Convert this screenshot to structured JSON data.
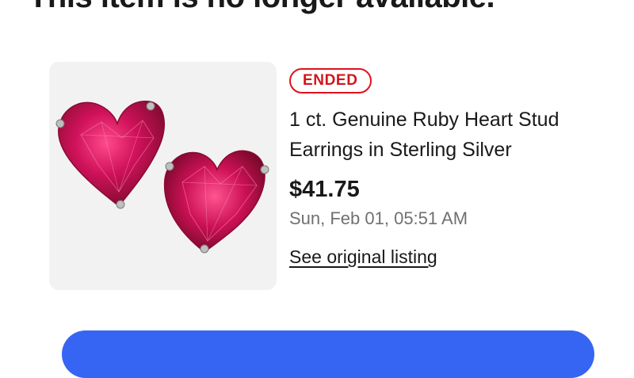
{
  "page": {
    "headline": "This item is no longer available."
  },
  "listing": {
    "status_badge": "ENDED",
    "title": "1 ct. Genuine Ruby Heart Stud Earrings in Sterling Silver",
    "price": "$41.75",
    "ended_date": "Sun, Feb 01, 05:51 AM",
    "original_listing_link": "See original listing",
    "image_icon": "ruby-heart-stud-earrings-image"
  },
  "colors": {
    "badge_red": "#e0121c",
    "link_text": "#191919",
    "muted_text": "#707070",
    "primary_blue": "#3665f3",
    "thumb_bg": "#f2f2f2",
    "ruby": "#c2124b"
  }
}
